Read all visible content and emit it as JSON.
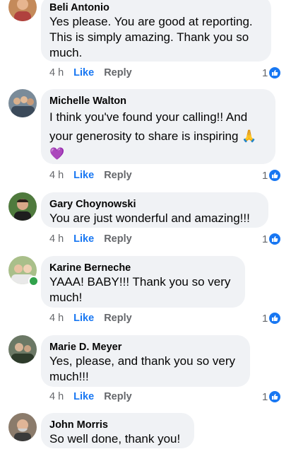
{
  "comments": [
    {
      "author": "Beli Antonio",
      "lines": [
        "Yes please. You are good at reporting.",
        "This is simply amazing. Thank you so",
        "much."
      ],
      "time": "4 h",
      "like_label": "Like",
      "reply_label": "Reply",
      "reactions": "1",
      "avatar_color": "#c9744f"
    },
    {
      "author": "Michelle Walton",
      "lines": [
        "I think you've found your calling!!  And",
        "your generosity to share is inspiring 🙏",
        "💜"
      ],
      "time": "4 h",
      "like_label": "Like",
      "reply_label": "Reply",
      "reactions": "1",
      "avatar_color": "#6e7f8c"
    },
    {
      "author": "Gary Choynowski",
      "lines": [
        "You are just wonderful and amazing!!!"
      ],
      "time": "4 h",
      "like_label": "Like",
      "reply_label": "Reply",
      "reactions": "1",
      "avatar_color": "#3e5a36"
    },
    {
      "author": "Karine Berneche",
      "lines": [
        "YAAA! BABY!!! Thank you so very",
        "much!"
      ],
      "time": "4 h",
      "like_label": "Like",
      "reply_label": "Reply",
      "reactions": "1",
      "avatar_color": "#9bb07a",
      "online": true
    },
    {
      "author": "Marie D. Meyer",
      "lines": [
        "Yes, please, and thank you so very",
        "much!!!"
      ],
      "time": "4 h",
      "like_label": "Like",
      "reply_label": "Reply",
      "reactions": "1",
      "avatar_color": "#5c6b5a"
    },
    {
      "author": "John Morris",
      "lines": [
        "So well done, thank you!"
      ],
      "avatar_color": "#8a7a6a"
    }
  ],
  "colors": {
    "like_blue": "#1877f2",
    "bubble_gray": "#f0f2f5",
    "meta_gray": "#65676b"
  }
}
